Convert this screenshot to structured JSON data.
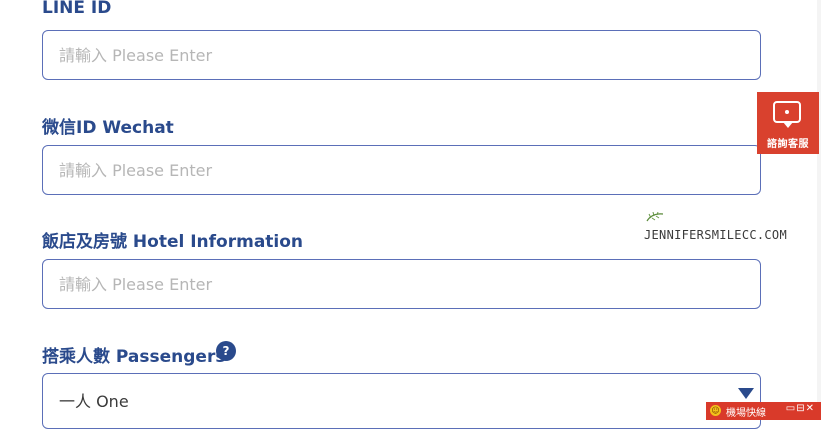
{
  "form": {
    "line": {
      "label": "LINE ID",
      "placeholder": "請輸入 Please Enter"
    },
    "wechat": {
      "label": "微信ID Wechat",
      "placeholder": "請輸入 Please Enter"
    },
    "hotel": {
      "label": "飯店及房號 Hotel Information",
      "placeholder": "請輸入 Please Enter"
    },
    "passengers": {
      "label": "搭乘人數 Passengers",
      "help": "?",
      "selected": "一人 One"
    }
  },
  "service": {
    "label": "諮詢客服"
  },
  "watermark": {
    "text": "JENNIFERSMILECC.COM"
  },
  "bottom_bar": {
    "label": "機場快線",
    "controls": "▭⊟✕"
  },
  "colors": {
    "accent": "#2a4a8c",
    "service_bg": "#d9412e",
    "bottom_bar_bg": "#d93a2a"
  }
}
